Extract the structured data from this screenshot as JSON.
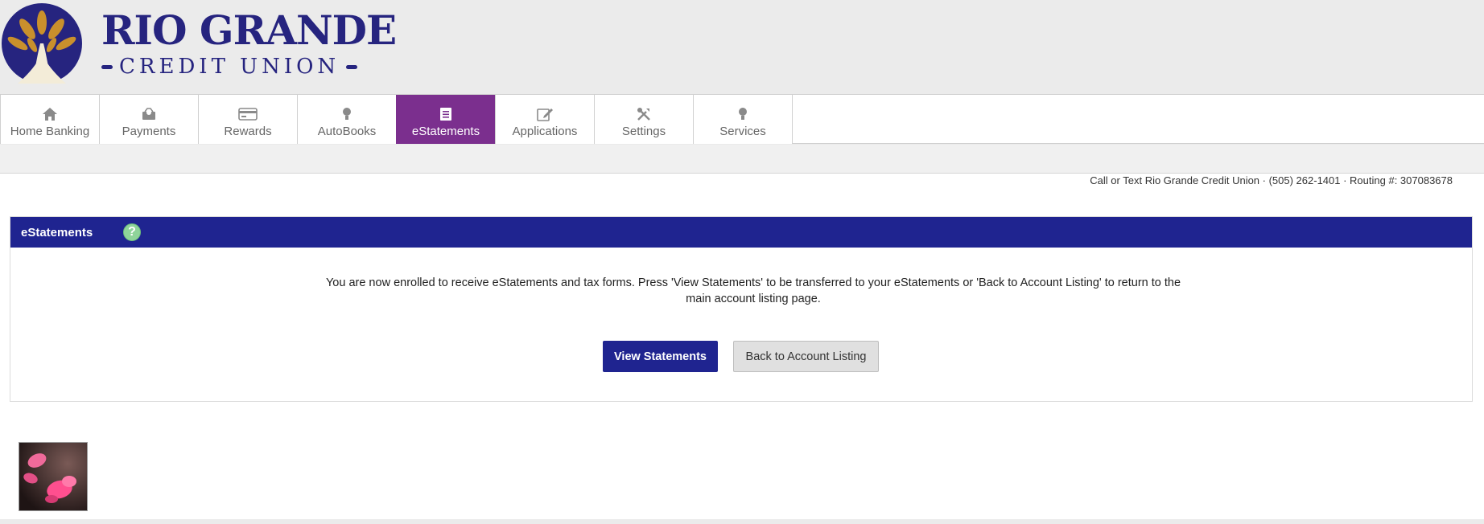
{
  "brand": {
    "name_top": "RIO GRANDE",
    "name_bottom": "CREDIT UNION",
    "colors": {
      "navy": "#26247f",
      "gold": "#c9902c",
      "active_tab": "#7b2f8e",
      "panel_header": "#1f2490"
    }
  },
  "nav": {
    "items": [
      {
        "label": "Home Banking",
        "icon": "home-icon",
        "active": false
      },
      {
        "label": "Payments",
        "icon": "payments-icon",
        "active": false
      },
      {
        "label": "Rewards",
        "icon": "credit-card-icon",
        "active": false
      },
      {
        "label": "AutoBooks",
        "icon": "lightbulb-icon",
        "active": false
      },
      {
        "label": "eStatements",
        "icon": "document-icon",
        "active": true
      },
      {
        "label": "Applications",
        "icon": "edit-icon",
        "active": false
      },
      {
        "label": "Settings",
        "icon": "tools-icon",
        "active": false
      },
      {
        "label": "Services",
        "icon": "lightbulb-icon",
        "active": false
      }
    ]
  },
  "contact": {
    "text": "Call or Text Rio Grande Credit Union · (505) 262-1401 · Routing #: 307083678"
  },
  "panel": {
    "title": "eStatements",
    "help_icon": "help-icon",
    "message": "You are now enrolled to receive eStatements and tax forms. Press 'View Statements' to be transferred to your eStatements or 'Back to Account Listing' to return to the main account listing page.",
    "view_button": "View Statements",
    "back_button": "Back to Account Listing"
  },
  "thumbnail": {
    "icon": "flower-petals-image"
  }
}
